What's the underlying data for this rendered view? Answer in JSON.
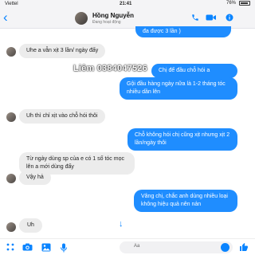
{
  "status_bar": {
    "carrier": "Viettel",
    "time": "21:41",
    "battery": "76%"
  },
  "header": {
    "contact_name": "Hồng Nguyễn",
    "status": "Đang hoạt động"
  },
  "watermark": "Liêm 0384047526",
  "messages": [
    {
      "id": "m0",
      "side": "out",
      "text": "đa được 3 lần )"
    },
    {
      "id": "m1",
      "side": "in",
      "text": "Uhe a vẫn xịt 3 lần/ ngày đấy"
    },
    {
      "id": "m2",
      "side": "out",
      "text": "Chị để đầu chỗ hói a"
    },
    {
      "id": "m3",
      "side": "out",
      "text": "Gội đầu hàng ngày nữa là 1-2 tháng tóc nhiều dần lên"
    },
    {
      "id": "m4",
      "side": "in",
      "text": "Uh thì chỉ xịt vào chỗ hói thôi"
    },
    {
      "id": "m5",
      "side": "out",
      "text": "Chỗ không hói chị cũng xịt nhưng xịt 2 lần/ngày thôi"
    },
    {
      "id": "m6",
      "side": "in",
      "text": "Từ ngày dùng sp của e có 1 số tóc mọc lên a mới dùng đấy"
    },
    {
      "id": "m7",
      "side": "in",
      "text": "Vậy hả"
    },
    {
      "id": "m8",
      "side": "out",
      "text": "Vâng chị, chắc anh dùng nhiều loại không hiệu quả nên nản"
    },
    {
      "id": "m9",
      "side": "in",
      "text": "Uh"
    }
  ],
  "composer": {
    "placeholder": "Aa"
  },
  "colors": {
    "accent": "#0a84ff",
    "outgoing_bubble": "#1f8dff",
    "incoming_bubble": "#ececec"
  },
  "icons": [
    "back-chevron-icon",
    "phone-icon",
    "video-camera-icon",
    "info-icon",
    "apps-icon",
    "camera-icon",
    "photo-icon",
    "microphone-icon",
    "emoji-icon",
    "thumbs-up-icon",
    "arrow-down-icon"
  ]
}
